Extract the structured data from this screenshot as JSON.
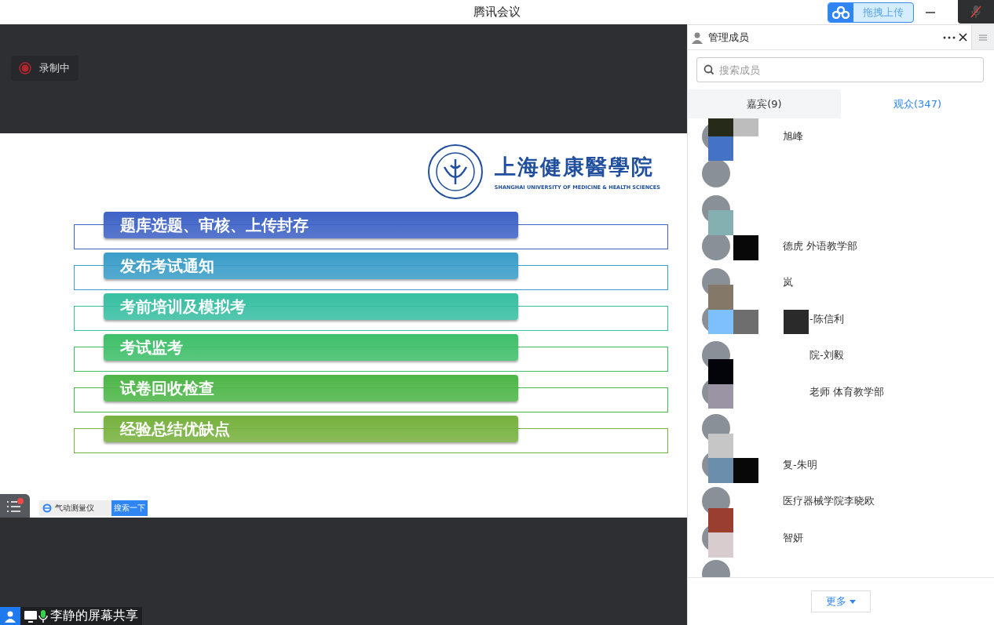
{
  "window": {
    "title": "腾讯会议",
    "upload_button": "拖拽上传",
    "mic_muted": true
  },
  "recording": {
    "label": "录制中"
  },
  "slide": {
    "logo": {
      "name": "上海健康醫學院",
      "subtitle": "SHANGHAI UNIVERSITY OF MEDICINE & HEALTH SCIENCES"
    },
    "steps": [
      {
        "label": "题库选题、审核、上传封存",
        "color": "#3f63c6"
      },
      {
        "label": "发布考试通知",
        "color": "#3b9dc8"
      },
      {
        "label": "考前培训及模拟考",
        "color": "#38bfa2"
      },
      {
        "label": "考试监考",
        "color": "#3fbf6a"
      },
      {
        "label": "试卷回收检查",
        "color": "#4db648"
      },
      {
        "label": "经验总结优缺点",
        "color": "#77b13f"
      }
    ],
    "toolbar": {
      "search_value": "气动测量仪",
      "search_button": "搜索一下"
    }
  },
  "share_label": {
    "text": "李静的屏幕共享"
  },
  "panel": {
    "title": "管理成员",
    "search": {
      "placeholder": "搜索成员"
    },
    "tabs": [
      {
        "label": "嘉宾(9)",
        "selected": false
      },
      {
        "label": "观众(347)",
        "selected": true
      }
    ],
    "members": [
      {
        "kind": "named",
        "name": "旭峰"
      },
      {
        "kind": "blank"
      },
      {
        "kind": "blank"
      },
      {
        "kind": "named",
        "name": "德虎 外语教学部"
      },
      {
        "kind": "named",
        "name": "岚"
      },
      {
        "kind": "indented",
        "name": "-陈信利"
      },
      {
        "kind": "indented",
        "name": "院-刘毅"
      },
      {
        "kind": "indented",
        "name": "老师 体育教学部"
      },
      {
        "kind": "blank"
      },
      {
        "kind": "named",
        "name": "复-朱明"
      },
      {
        "kind": "named",
        "name": "医疗器械学院李晓欧"
      },
      {
        "kind": "named",
        "name": "智妍"
      },
      {
        "kind": "blank"
      }
    ],
    "mosaic": [
      [
        {
          "kind": "block",
          "color": "#262a18"
        },
        {
          "kind": "block",
          "color": "#bdbdbd"
        }
      ],
      [
        {
          "kind": "block",
          "color": "#4472c4"
        }
      ],
      [
        {
          "kind": "gap"
        }
      ],
      [
        {
          "kind": "gap"
        }
      ],
      [
        {
          "kind": "block",
          "color": "#84b0b2"
        }
      ],
      [
        {
          "kind": "gap"
        },
        {
          "kind": "block",
          "color": "#080808"
        }
      ],
      [
        {
          "kind": "gap"
        }
      ],
      [
        {
          "kind": "block",
          "color": "#847868"
        }
      ],
      [
        {
          "kind": "block",
          "color": "#7ec0fe"
        },
        {
          "kind": "block",
          "color": "#6e6e6e"
        },
        {
          "kind": "gap"
        },
        {
          "kind": "block",
          "color": "#2a2a2a"
        }
      ],
      [
        {
          "kind": "gap"
        }
      ],
      [
        {
          "kind": "block",
          "color": "#03030a"
        }
      ],
      [
        {
          "kind": "block",
          "color": "#9a94a4"
        }
      ],
      [
        {
          "kind": "gap"
        }
      ],
      [
        {
          "kind": "block",
          "color": "#c6c6c6"
        }
      ],
      [
        {
          "kind": "block",
          "color": "#6a8eac"
        },
        {
          "kind": "block",
          "color": "#080808"
        }
      ],
      [
        {
          "kind": "gap"
        }
      ],
      [
        {
          "kind": "block",
          "color": "#9a3e30"
        }
      ],
      [
        {
          "kind": "block",
          "color": "#d8ccce"
        }
      ]
    ],
    "more_button": "更多"
  }
}
